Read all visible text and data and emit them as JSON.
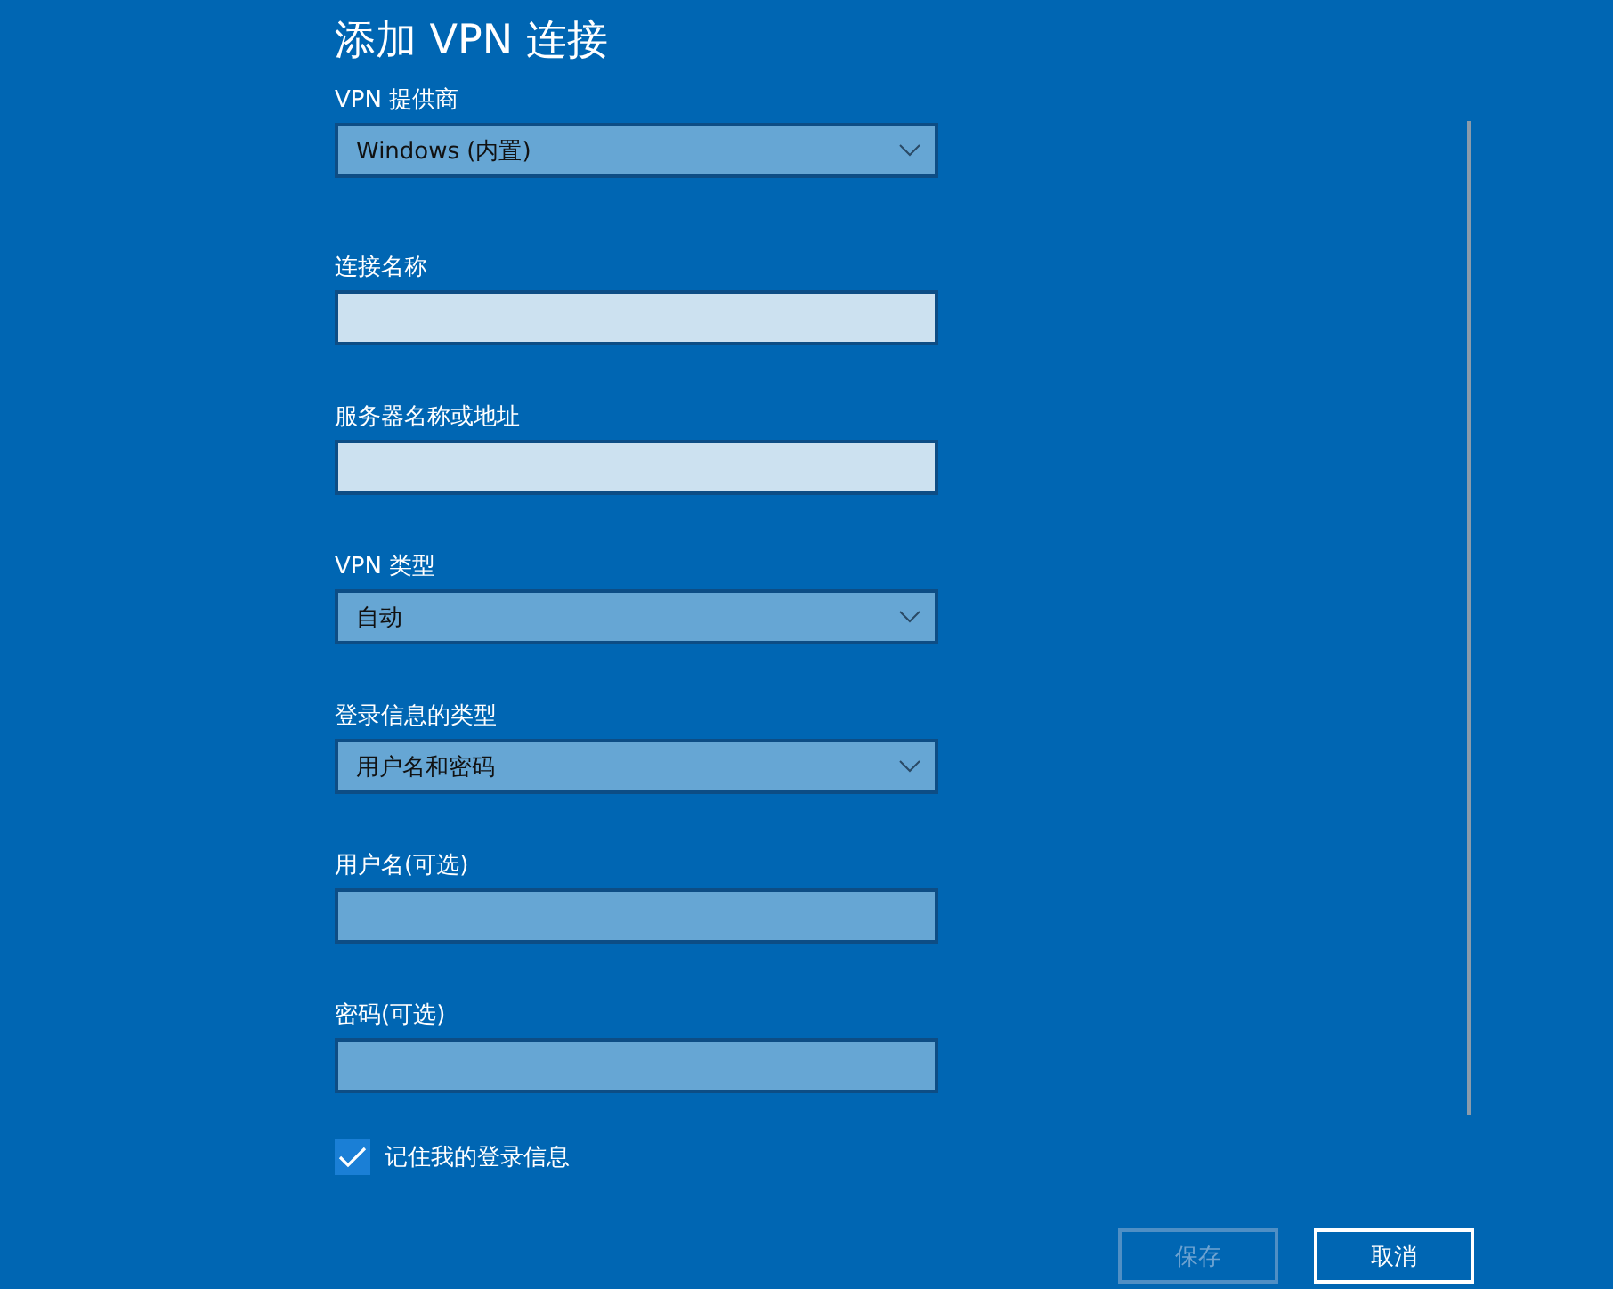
{
  "title": "添加 VPN 连接",
  "fields": [
    {
      "label": "VPN 提供商",
      "kind": "dropdown",
      "value": "Windows (内置)",
      "active": false
    },
    {
      "label": "连接名称",
      "kind": "text",
      "active": true
    },
    {
      "label": "服务器名称或地址",
      "kind": "text",
      "active": true
    },
    {
      "label": "VPN 类型",
      "kind": "dropdown",
      "value": "自动",
      "active": false
    },
    {
      "label": "登录信息的类型",
      "kind": "dropdown",
      "value": "用户名和密码",
      "active": false
    },
    {
      "label": "用户名(可选)",
      "kind": "text",
      "active": false
    },
    {
      "label": "密码(可选)",
      "kind": "text",
      "active": false
    }
  ],
  "remember": {
    "label": "记住我的登录信息",
    "checked": true
  },
  "buttons": [
    {
      "label": "保存",
      "disabled": true
    },
    {
      "label": "取消",
      "disabled": false
    }
  ]
}
